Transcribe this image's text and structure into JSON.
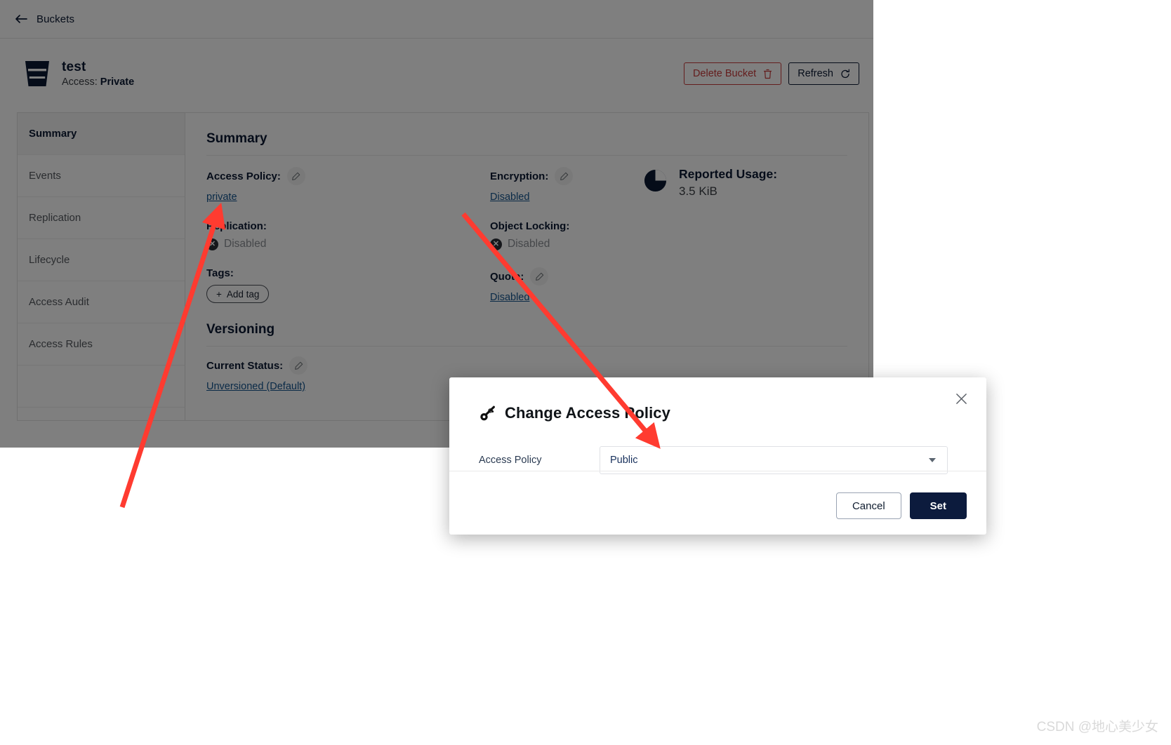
{
  "topbar": {
    "back_icon": "arrow-left-icon",
    "breadcrumb": "Buckets"
  },
  "bucket": {
    "icon": "bucket-icon",
    "name": "test",
    "access_prefix": "Access: ",
    "access_value": "Private",
    "delete_label": "Delete Bucket",
    "delete_icon": "trash-icon",
    "refresh_label": "Refresh",
    "refresh_icon": "refresh-icon"
  },
  "sidebar": {
    "items": [
      {
        "label": "Summary",
        "active": true
      },
      {
        "label": "Events",
        "active": false
      },
      {
        "label": "Replication",
        "active": false
      },
      {
        "label": "Lifecycle",
        "active": false
      },
      {
        "label": "Access Audit",
        "active": false
      },
      {
        "label": "Access Rules",
        "active": false
      }
    ]
  },
  "summary": {
    "title": "Summary",
    "access_policy_label": "Access Policy:",
    "access_policy_value": "private",
    "encryption_label": "Encryption:",
    "encryption_value": "Disabled",
    "reported_usage_label": "Reported Usage:",
    "reported_usage_value": "3.5 KiB",
    "replication_label": "Replication:",
    "replication_value": "Disabled",
    "object_locking_label": "Object Locking:",
    "object_locking_value": "Disabled",
    "tags_label": "Tags:",
    "add_tag_label": "Add tag",
    "quota_label": "Quota:",
    "quota_value": "Disabled",
    "versioning_title": "Versioning",
    "current_status_label": "Current Status:",
    "current_status_value": "Unversioned (Default)"
  },
  "modal": {
    "title": "Change Access Policy",
    "title_icon": "key-icon",
    "close_icon": "close-icon",
    "field_label": "Access Policy",
    "field_value": "Public",
    "dropdown_icon": "chevron-down-icon",
    "cancel_label": "Cancel",
    "set_label": "Set"
  },
  "colors": {
    "brand_navy": "#0c1b3d",
    "danger_red": "#c83b3b",
    "link_blue": "#14558f",
    "annotation_red": "#ff3b30"
  },
  "watermark": {
    "text": "CSDN @地心美少女"
  }
}
